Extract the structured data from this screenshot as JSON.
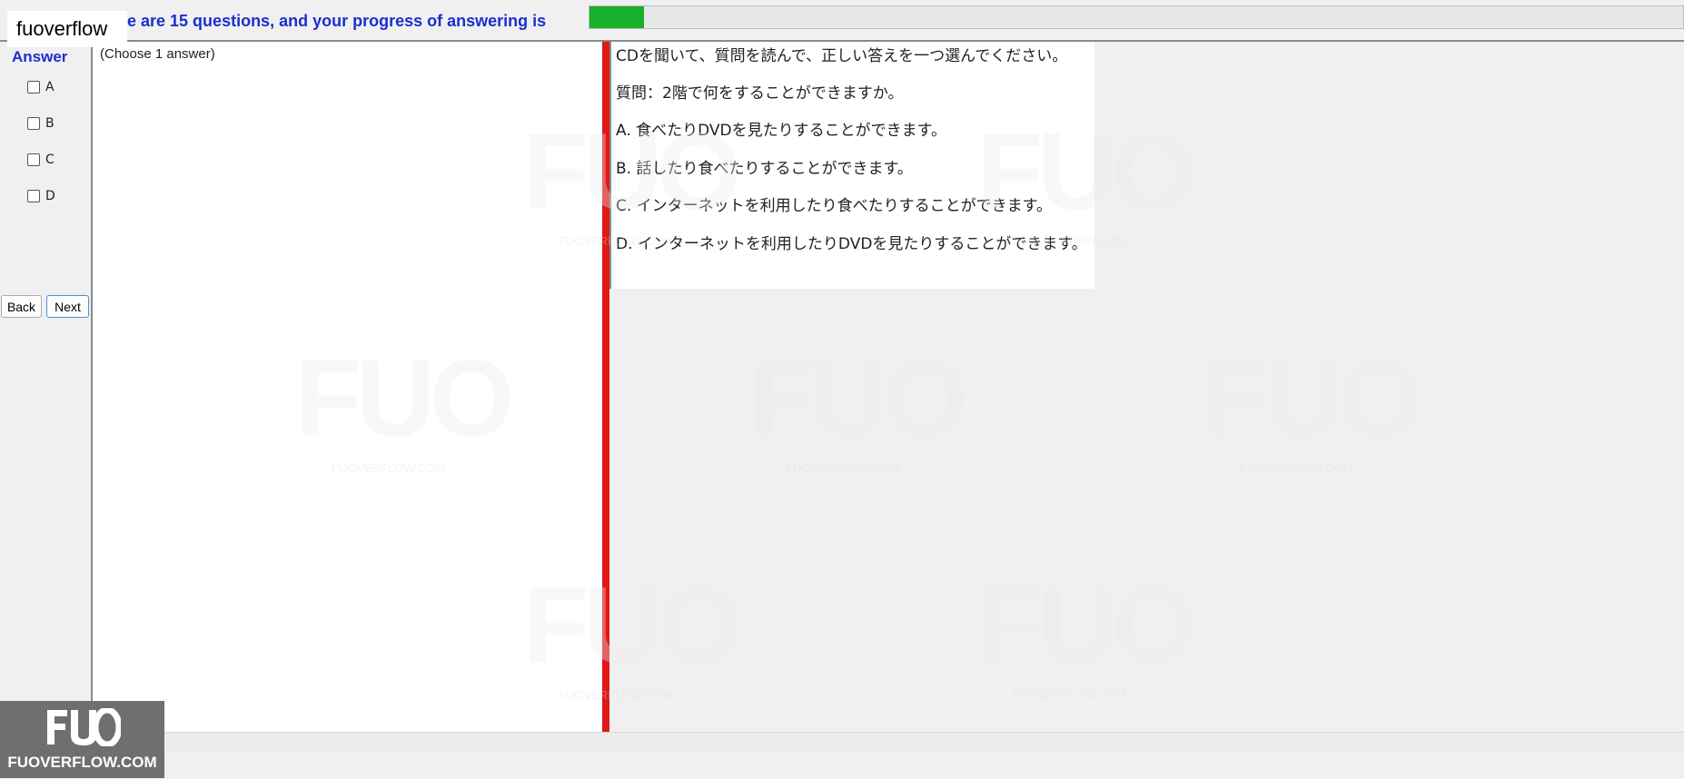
{
  "header": {
    "brand_label": "fuoverflow",
    "progress_text": "e are 15 questions, and your progress of answering is",
    "progress_fraction": 0.05
  },
  "answer_panel": {
    "title": "Answer",
    "options": [
      "A",
      "B",
      "C",
      "D"
    ],
    "back_label": "Back",
    "next_label": "Next"
  },
  "middle": {
    "instruction": "(Choose 1 answer)"
  },
  "question": {
    "instruction": "CDを聞いて、質問を読んで、正しい答えを一つ選んでください。",
    "prompt": "質問：2階で何をすることができますか。",
    "choices": [
      "A.  食べたりDVDを見たりすることができます。",
      "B.  話したり食べたりすることができます。",
      "C.  インターネットを利用したり食べたりすることができます。",
      "D.  インターネットを利用したりDVDを見たりすることができます。"
    ]
  },
  "watermark": {
    "mark": "FUO",
    "sub": "FUOVERFLOW.COM"
  },
  "logo": {
    "mark": "FUO",
    "text": "FUOVERFLOW.COM"
  },
  "colors": {
    "accent_blue": "#1a2fd0",
    "progress_green": "#18b02a",
    "divider_red": "#e01818"
  }
}
